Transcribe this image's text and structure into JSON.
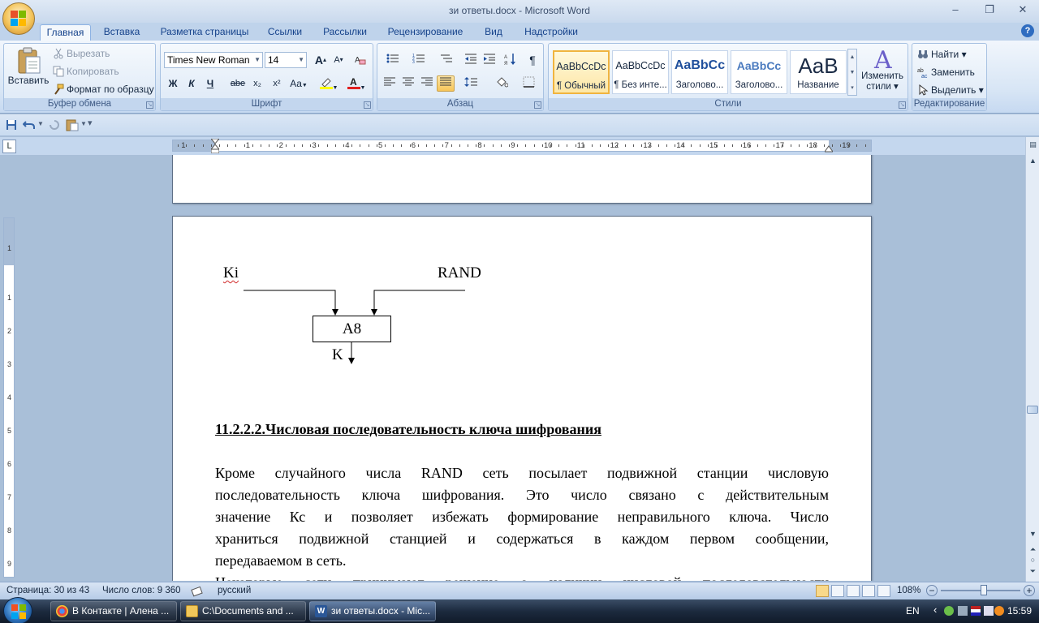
{
  "window": {
    "title": "зи ответы.docx - Microsoft Word",
    "minimize": "–",
    "maximize": "❐",
    "close": "✕"
  },
  "tabs": [
    "Главная",
    "Вставка",
    "Разметка страницы",
    "Ссылки",
    "Рассылки",
    "Рецензирование",
    "Вид",
    "Надстройки"
  ],
  "active_tab": "Главная",
  "help": "?",
  "clipboard": {
    "paste": "Вставить",
    "cut": "Вырезать",
    "copy": "Копировать",
    "format_painter": "Формат по образцу",
    "label": "Буфер обмена"
  },
  "font": {
    "name": "Times New Roman",
    "size": "14",
    "bold": "Ж",
    "italic": "К",
    "underline": "Ч",
    "strike": "abe",
    "subscript": "x₂",
    "superscript": "x²",
    "change_case": "Aa",
    "grow": "A",
    "shrink": "A",
    "label": "Шрифт",
    "highlight_color": "#ffff00",
    "font_color": "#e02020"
  },
  "paragraph": {
    "label": "Абзац",
    "show_marks": "¶"
  },
  "styles": {
    "label": "Стили",
    "items": [
      {
        "preview": "AaBbCcDc",
        "name": "¶ Обычный"
      },
      {
        "preview": "AaBbCcDc",
        "name": "¶ Без инте..."
      },
      {
        "preview": "AaBbCc",
        "name": "Заголово..."
      },
      {
        "preview": "AaBbCc",
        "name": "Заголово..."
      },
      {
        "preview": "AaB",
        "name": "Название"
      }
    ],
    "change_styles_line1": "Изменить",
    "change_styles_line2": "стили"
  },
  "editing": {
    "label": "Редактирование",
    "find": "Найти",
    "replace": "Заменить",
    "select": "Выделить"
  },
  "ruler": {
    "tab_selector": "L",
    "numbers": [
      "1",
      "1",
      "2",
      "3",
      "4",
      "5",
      "6",
      "7",
      "8",
      "9",
      "10",
      "11",
      "12",
      "13",
      "14",
      "15",
      "16",
      "17",
      "18",
      "19"
    ],
    "vnumbers": [
      "1",
      "1",
      "2",
      "3",
      "4",
      "5",
      "6",
      "7",
      "8",
      "9"
    ]
  },
  "document": {
    "diagram": {
      "input_left": "Ki",
      "input_right": "RAND",
      "block": "A8",
      "output": "K"
    },
    "heading": "11.2.2.2.Числовая последовательность ключа шифрования",
    "paragraph_lines": [
      "Кроме случайного числа RAND сеть посылает подвижной станции числовую",
      "последовательность ключа шифрования. Это число связано с действительным",
      "значение Кс и позволяет избежать формирование неправильного ключа. Число",
      "храниться подвижной станцией и содержаться в каждом первом сообщении,",
      "передаваемом в сеть."
    ],
    "partial_line": "Некоторые сети принимают решение о наличии числовой последовательности"
  },
  "status": {
    "page": "Страница: 30 из 43",
    "words": "Число слов: 9 360",
    "language": "русский",
    "zoom": "108%",
    "zoom_minus": "−",
    "zoom_plus": "+",
    "zoom_level": 0.42
  },
  "taskbar": {
    "tasks": [
      "В Контакте | Алена ...",
      "C:\\Documents and ...",
      "зи ответы.docx - Mic..."
    ],
    "lang": "EN",
    "time": "15:59"
  }
}
